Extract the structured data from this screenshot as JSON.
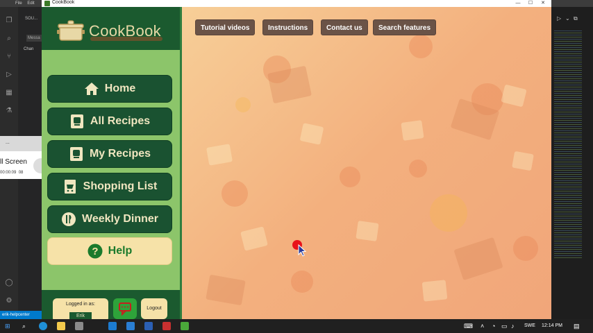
{
  "vscode": {
    "menu": [
      "File",
      "Edit"
    ],
    "sidebar_title": "SOU...",
    "message_placeholder": "Messa",
    "changes_label": "Chan",
    "status_text": "erik-helpcenter",
    "recorder_title": "...",
    "recorder_big": "ll Screen",
    "recorder_time": "00:00:09",
    "recorder_num": "08"
  },
  "app": {
    "window_title": "CookBook",
    "brand": "CookBook",
    "nav": [
      {
        "label": "Home",
        "icon": "home-icon"
      },
      {
        "label": "All Recipes",
        "icon": "recipe-book-icon"
      },
      {
        "label": "My Recipes",
        "icon": "recipe-book-icon"
      },
      {
        "label": "Shopping List",
        "icon": "shopping-list-icon"
      },
      {
        "label": "Weekly Dinner",
        "icon": "fork-knife-icon"
      },
      {
        "label": "Help",
        "icon": "question-icon"
      }
    ],
    "top_buttons": [
      "Tutorial videos",
      "Instructions",
      "Contact us",
      "Search features"
    ],
    "login_label": "Logged in as:",
    "username": "Erik",
    "logout_label": "Logout"
  },
  "taskbar": {
    "language": "SWE",
    "time": "12:14 PM"
  },
  "colors": {
    "sidebar_green": "#8cc56a",
    "dark_green": "#1a5231",
    "help_cream": "#f6e2a8",
    "nav_button_text": "#f0e6c0",
    "top_button_bg": "#6a5347"
  }
}
